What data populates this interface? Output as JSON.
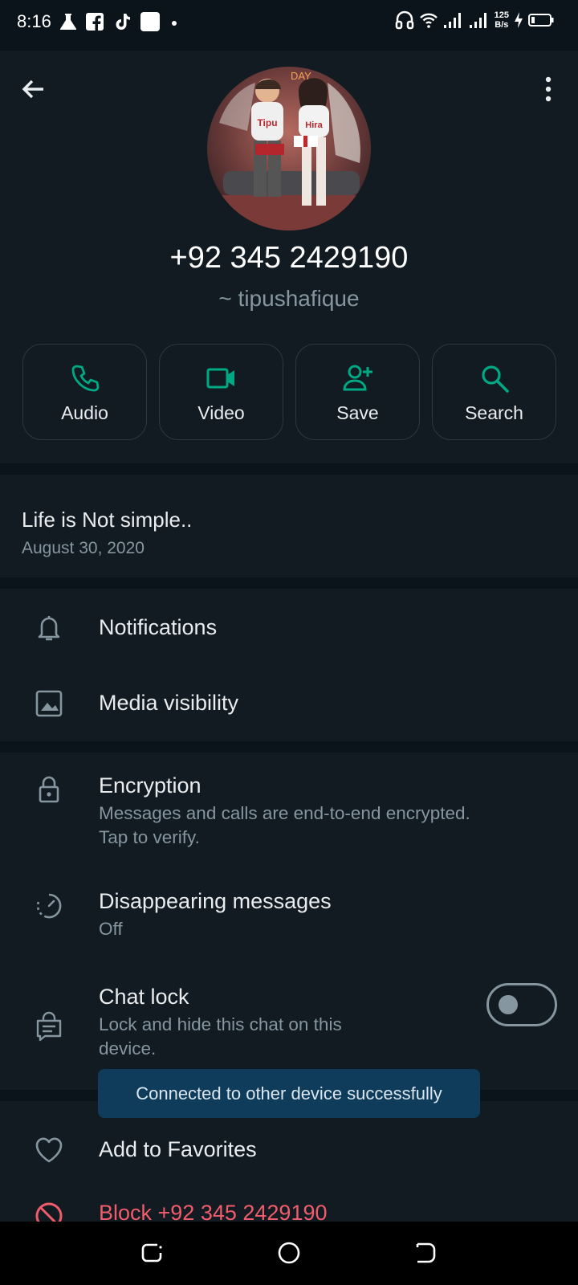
{
  "status_bar": {
    "time": "8:16",
    "net_speed_value": "125",
    "net_speed_unit": "B/s"
  },
  "profile": {
    "phone": "+92 345 2429190",
    "username": "~ tipushafique",
    "avatar_texts": [
      "Tipu",
      "Hira",
      "DAY"
    ]
  },
  "actions": [
    {
      "label": "Audio",
      "icon": "phone-icon"
    },
    {
      "label": "Video",
      "icon": "video-icon"
    },
    {
      "label": "Save",
      "icon": "add-user-icon"
    },
    {
      "label": "Search",
      "icon": "search-icon"
    }
  ],
  "about": {
    "text": "Life is Not simple..",
    "date": "August 30, 2020"
  },
  "settings": {
    "notifications": "Notifications",
    "media_visibility": "Media visibility"
  },
  "privacy": {
    "encryption_title": "Encryption",
    "encryption_sub_1": "Messages and calls are end-to-end encrypted.",
    "encryption_sub_2": "Tap to verify.",
    "disappearing_title": "Disappearing messages",
    "disappearing_value": "Off",
    "chat_lock_title": "Chat lock",
    "chat_lock_sub_1": "Lock and hide this chat on this",
    "chat_lock_sub_2": "device.",
    "chat_lock_enabled": false
  },
  "more": {
    "favorites": "Add to Favorites",
    "block": "Block +92 345 2429190"
  },
  "toast": "Connected to other device successfully",
  "colors": {
    "background": "#0b141a",
    "surface": "#111b21",
    "accent": "#00a884",
    "danger": "#f15c6d",
    "toast": "#103c5b"
  }
}
